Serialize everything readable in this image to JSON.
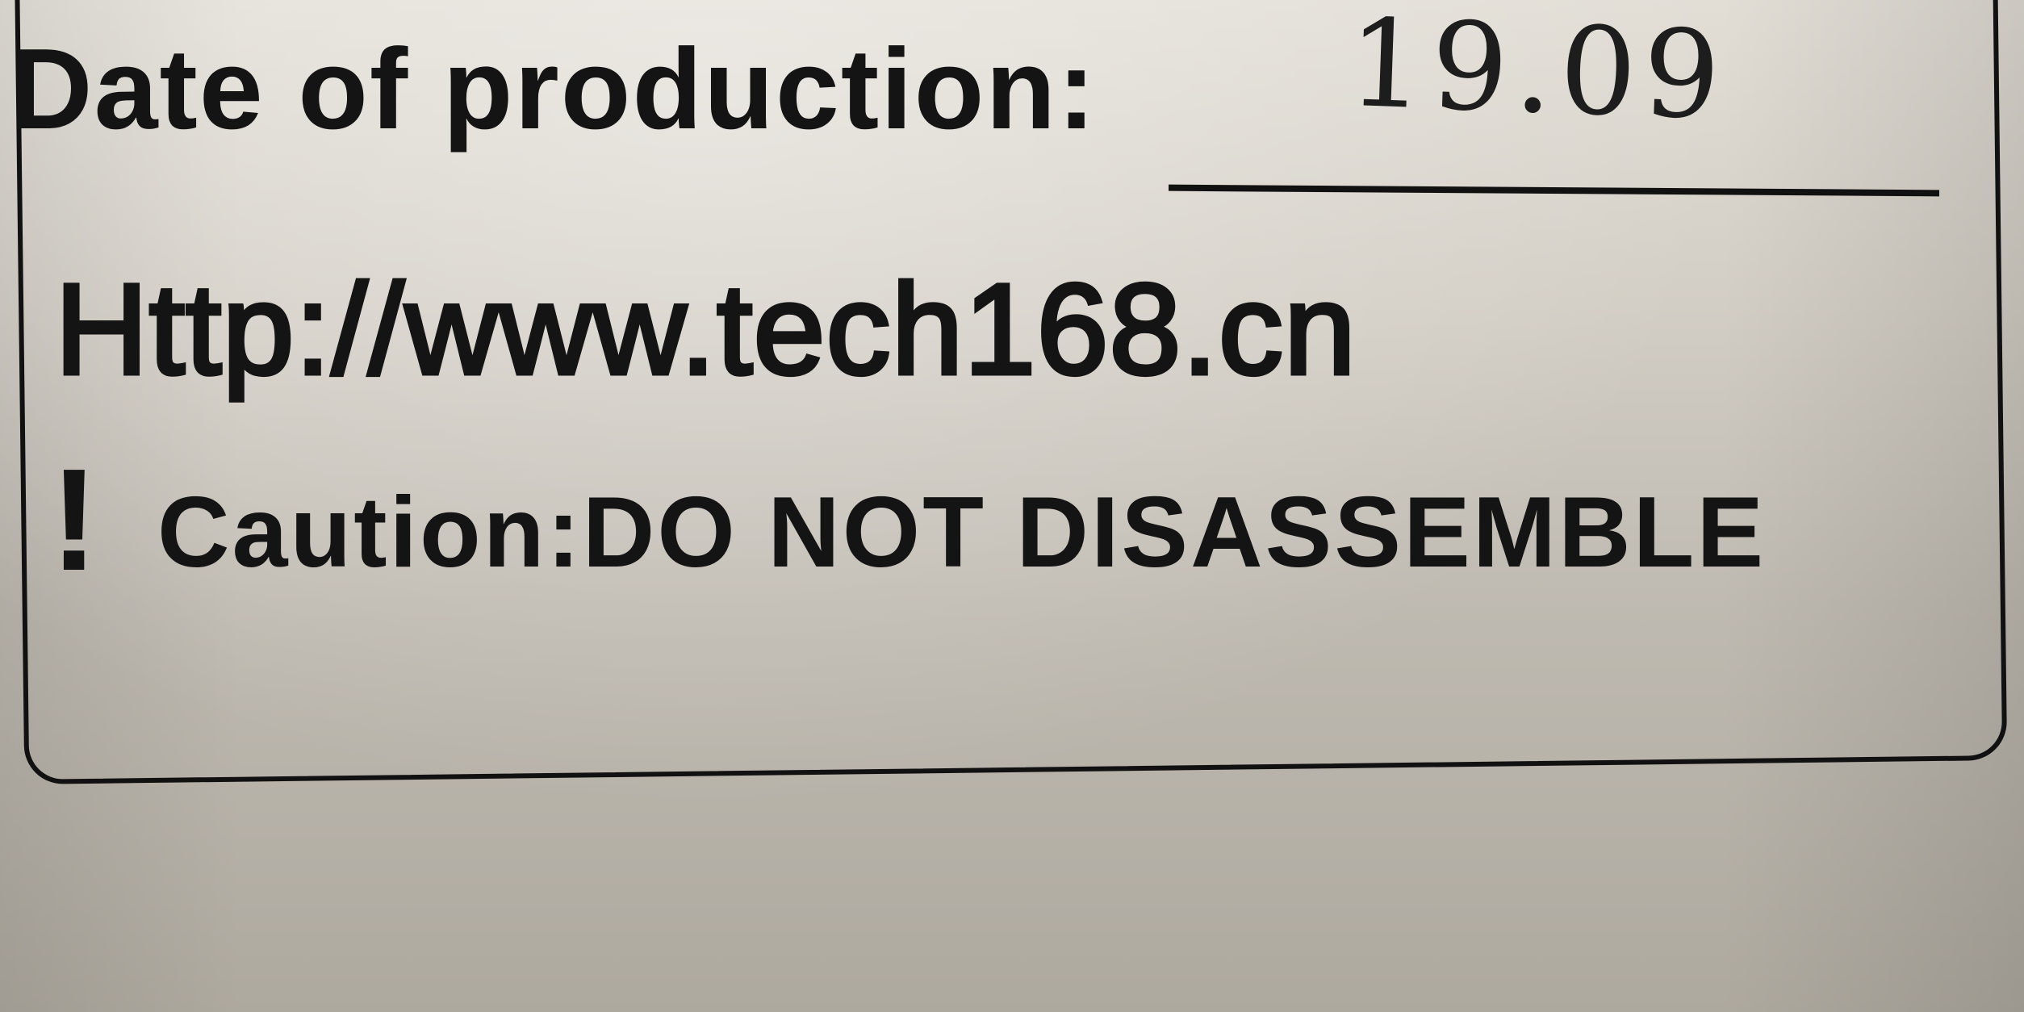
{
  "label": {
    "date_label": "Date of production:",
    "date_value_handwritten": "19.09",
    "website": "Http://www.tech168.cn",
    "warning_icon": "exclamation-mark",
    "caution_text": "Caution:DO NOT DISASSEMBLE"
  },
  "colors": {
    "surface": "#d3cec5",
    "ink": "#141414"
  }
}
